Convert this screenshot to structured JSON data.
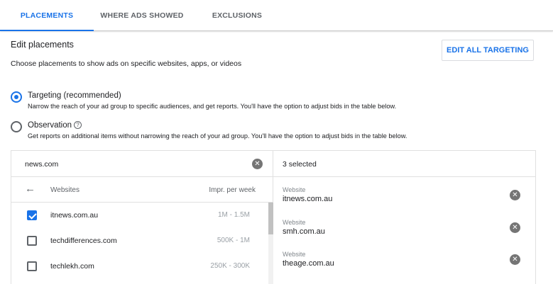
{
  "tabs": [
    {
      "label": "PLACEMENTS",
      "active": true
    },
    {
      "label": "WHERE ADS SHOWED",
      "active": false
    },
    {
      "label": "EXCLUSIONS",
      "active": false
    }
  ],
  "section": {
    "title": "Edit placements",
    "description": "Choose placements to show ads on specific websites, apps, or videos",
    "edit_all_label": "EDIT ALL TARGETING"
  },
  "radios": [
    {
      "label": "Targeting (recommended)",
      "description": "Narrow the reach of your ad group to specific audiences, and get reports. You'll have the option to adjust bids in the table below.",
      "checked": true
    },
    {
      "label": "Observation",
      "description": "Get reports on additional items without narrowing the reach of your ad group. You'll have the option to adjust bids in the table below.",
      "checked": false,
      "help_icon": "help-circle-icon"
    }
  ],
  "search": {
    "value": "news.com",
    "clear_icon": "clear-icon"
  },
  "browse": {
    "back_icon": "arrow-back-icon",
    "col_websites": "Websites",
    "col_impr": "Impr. per week",
    "rows": [
      {
        "site": "itnews.com.au",
        "impr": "1M - 1.5M",
        "checked": true
      },
      {
        "site": "techdifferences.com",
        "impr": "500K - 1M",
        "checked": false
      },
      {
        "site": "techlekh.com",
        "impr": "250K - 300K",
        "checked": false
      }
    ]
  },
  "selected": {
    "count_label": "3 selected",
    "items": [
      {
        "type": "Website",
        "site": "itnews.com.au"
      },
      {
        "type": "Website",
        "site": "smh.com.au"
      },
      {
        "type": "Website",
        "site": "theage.com.au"
      }
    ]
  },
  "colors": {
    "accent": "#1a73e8",
    "text": "#202124",
    "muted": "#5f6368",
    "border": "#e0e0e0"
  }
}
